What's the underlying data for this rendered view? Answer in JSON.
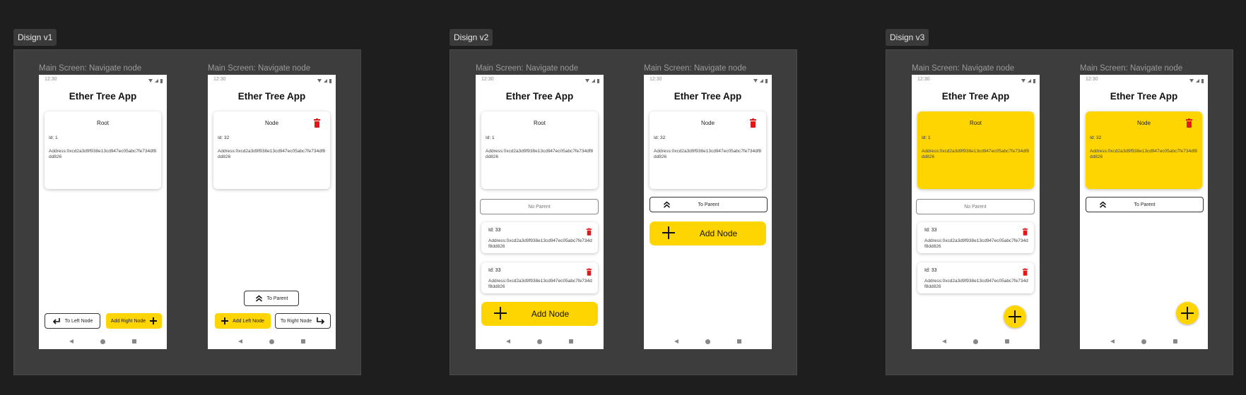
{
  "sections": [
    "Disign v1",
    "Disign v2",
    "Disign v3"
  ],
  "screen_title": "Main Screen: Navigate node",
  "status_time": "12:30",
  "app_title": "Ether Tree App",
  "root_card": {
    "title": "Root",
    "id": "Id: 1",
    "address": "Address:0xcd2a3d9f938e13cd947ec05abc7fe734df8dd826"
  },
  "node_card": {
    "title": "Node",
    "id": "Id: 32",
    "address": "Address:0xcd2a3d9f938e13cd947ec05abc7fe734df8dd826"
  },
  "child": {
    "id": "Id: 33",
    "address": "Address:0xcd2a3d9f938e13cd947ec05abc7fe734df8dd826"
  },
  "buttons": {
    "to_left_node": "To Left Node",
    "add_right_node": "Add Right Node",
    "to_parent": "To Parent",
    "add_left_node": "Add Left Node",
    "to_right_node": "To Right Node",
    "no_parent": "No Parent",
    "add_node": "Add Node"
  },
  "colors": {
    "accent": "#ffd500",
    "delete": "#e01818",
    "canvas": "#1e1e1e",
    "frame": "#3d3d3d"
  }
}
